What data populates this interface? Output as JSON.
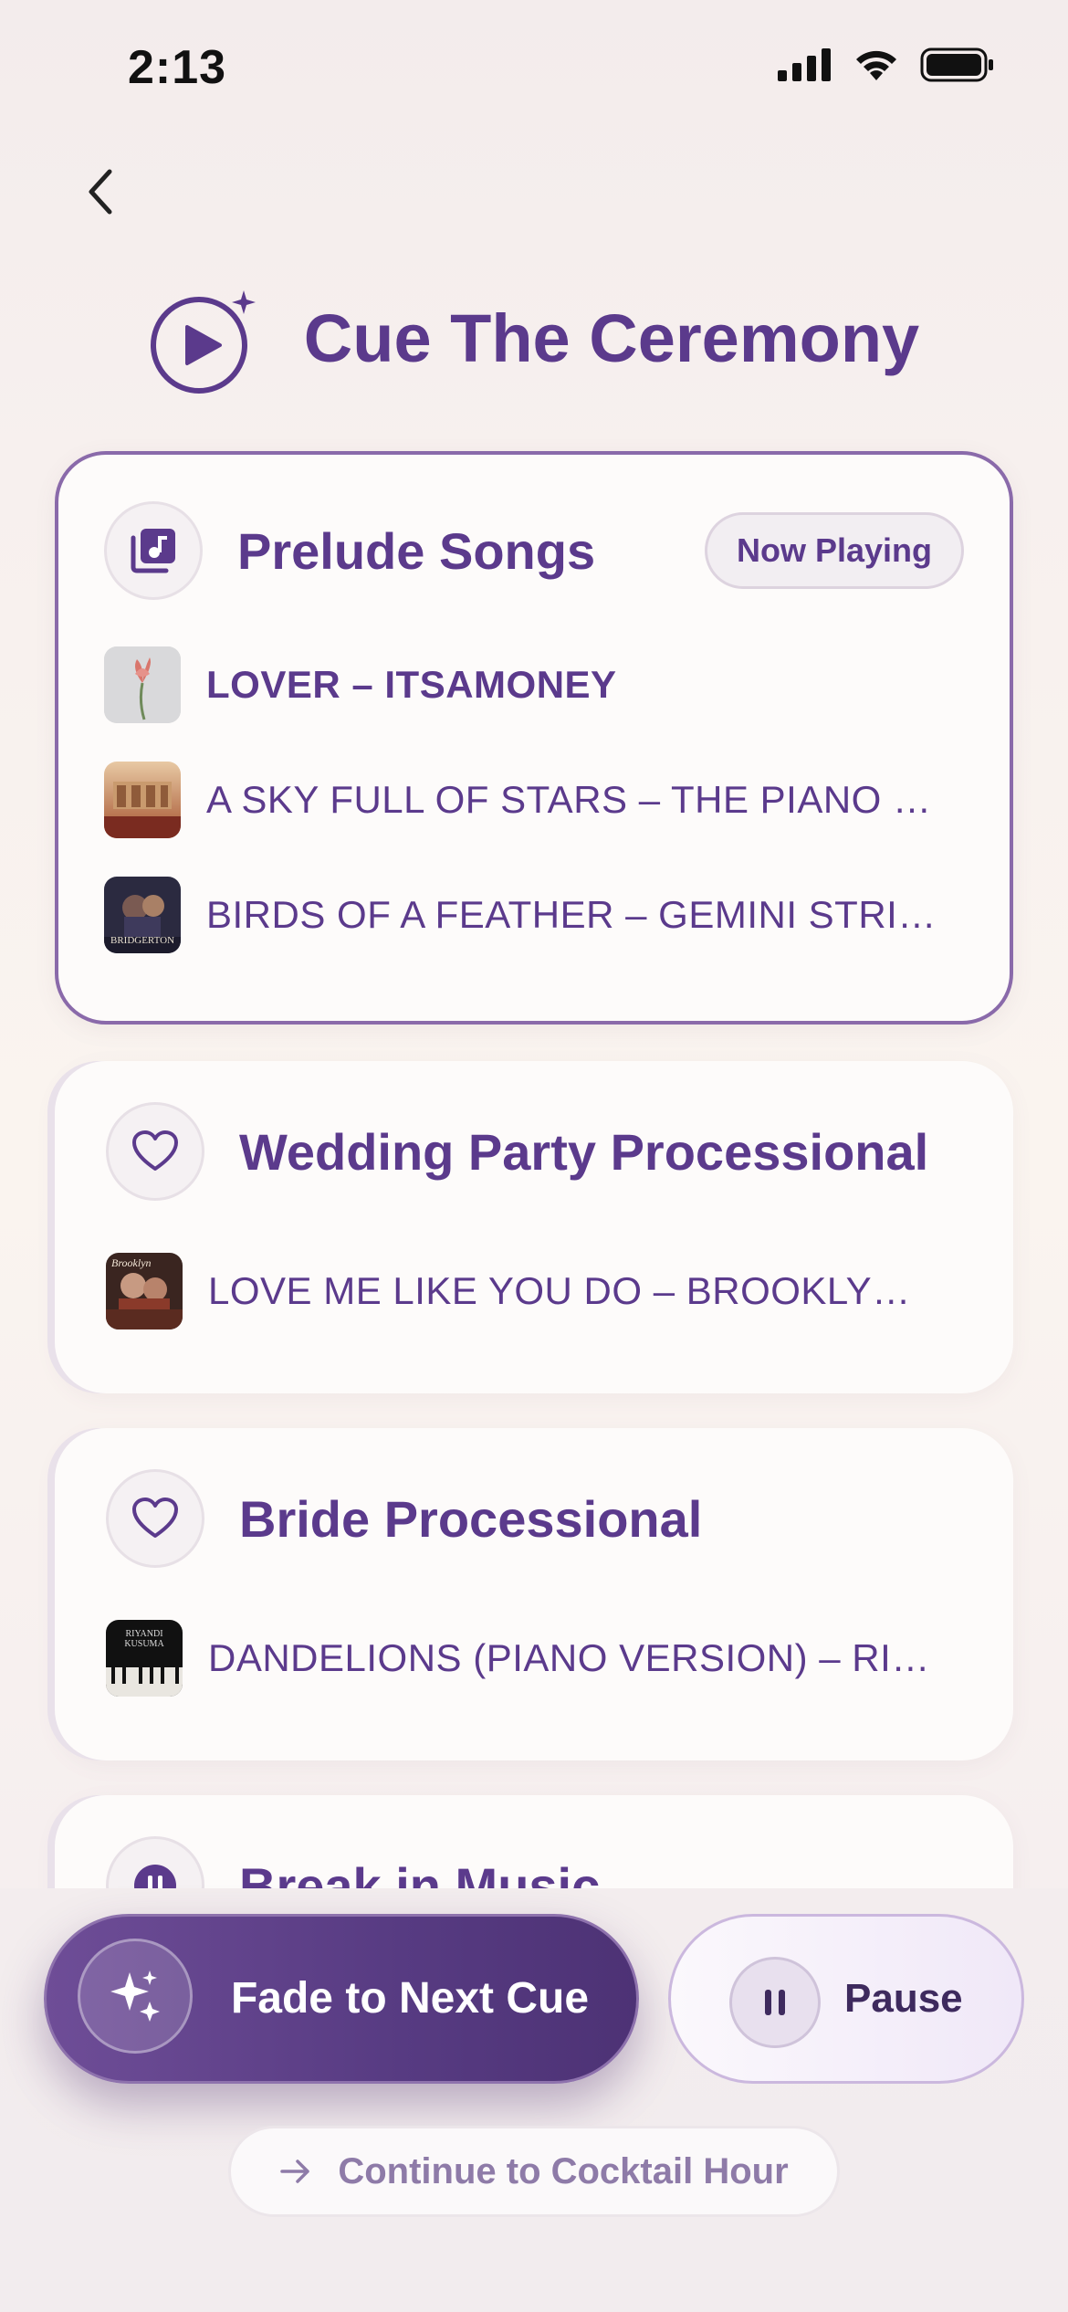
{
  "status_bar": {
    "time": "2:13"
  },
  "header": {
    "title": "Cue The Ceremony"
  },
  "cards": [
    {
      "title": "Prelude Songs",
      "badge": "Now Playing",
      "icon": "music-library-icon",
      "tracks": [
        {
          "label": "LOVER – ITSAMONEY",
          "art": "flower-art"
        },
        {
          "label": "A SKY FULL OF STARS – THE PIANO GUYS",
          "art": "piano-art"
        },
        {
          "label": "BIRDS OF A FEATHER – GEMINI STRINGS",
          "art": "bridgerton-art",
          "art_text": "BRIDGERTON"
        }
      ]
    },
    {
      "title": "Wedding Party Processional",
      "icon": "heart-icon",
      "tracks": [
        {
          "label": "LOVE ME LIKE YOU DO – BROOKLYN DUO",
          "art": "brooklyn-art",
          "art_text": "Brooklyn"
        }
      ]
    },
    {
      "title": "Bride Processional",
      "icon": "heart-icon",
      "tracks": [
        {
          "label": "DANDELIONS (PIANO VERSION) – RIYANDI KUSUMA",
          "art": "riyandi-art",
          "art_text": "RIYANDI KUSUMA"
        }
      ]
    },
    {
      "title": "Break in Music",
      "icon": "pause-icon"
    }
  ],
  "controls": {
    "fade_label": "Fade to Next Cue",
    "pause_label": "Pause",
    "continue_label": "Continue to Cocktail Hour"
  },
  "colors": {
    "accent": "#5b3a8c",
    "button_gradient_start": "#6e4d97",
    "button_gradient_end": "#4d3275",
    "background": "#f5efee"
  }
}
